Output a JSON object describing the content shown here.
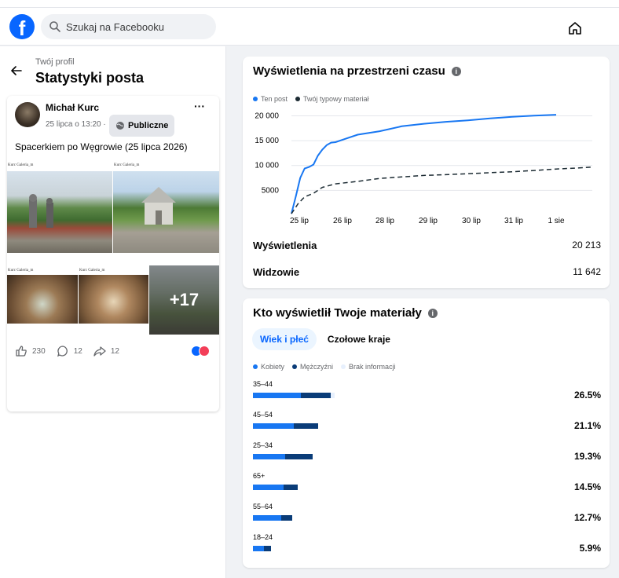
{
  "header": {
    "logo_letter": "f",
    "search_placeholder": "Szukaj na Facebooku",
    "home_icon": "home-icon"
  },
  "left": {
    "breadcrumb": "Twój profil",
    "title": "Statystyki posta"
  },
  "post": {
    "author": "Michał Kurc",
    "date": "25 lipca o 13:20 ·",
    "audience": "Publiczne",
    "more": "···",
    "text": "Spacerkiem po Węgrowie (25 lipca 2026)",
    "photo_title": "Kurc Galeria_m",
    "more_photos": "+17",
    "likes": "230",
    "comments": "12",
    "shares": "12",
    "colors": {
      "like": "#0866ff",
      "love": "#f33e58"
    }
  },
  "views_card": {
    "title": "Wyświetlenia na przestrzeni czasu",
    "info": "i",
    "legend": [
      {
        "label": "Ten post",
        "color": "#1877f2"
      },
      {
        "label": "Twój typowy materiał",
        "color": "#1c2b33"
      }
    ],
    "metrics": [
      {
        "label": "Wyświetlenia",
        "value": "20 213"
      },
      {
        "label": "Widzowie",
        "value": "11 642"
      }
    ]
  },
  "chart_data": {
    "type": "line",
    "title": "Wyświetlenia na przestrzeni czasu",
    "x_ticks": [
      "25 lip",
      "26 lip",
      "28 lip",
      "29 lip",
      "30 lip",
      "31 lip",
      "1 sie"
    ],
    "y_ticks": [
      "5000",
      "10 000",
      "15 000",
      "20 000"
    ],
    "ylim": [
      0,
      21500
    ],
    "x_range": [
      0,
      6.85
    ],
    "grid": true,
    "legend_position": "top-left",
    "series": [
      {
        "name": "Ten post",
        "color": "#1877f2",
        "dash": false,
        "x": [
          0,
          0.1,
          0.2,
          0.3,
          0.4,
          0.5,
          0.6,
          0.7,
          0.8,
          0.9,
          1.0,
          1.2,
          1.5,
          2.0,
          2.5,
          3.0,
          3.5,
          4.0,
          4.5,
          5.0,
          5.5,
          6.0
        ],
        "y": [
          300,
          3800,
          7500,
          9400,
          9700,
          10200,
          12000,
          13200,
          14100,
          14600,
          14700,
          15300,
          16200,
          16900,
          17900,
          18400,
          18800,
          19100,
          19500,
          19800,
          20050,
          20213
        ]
      },
      {
        "name": "Twój typowy materiał",
        "color": "#1c2b33",
        "dash": true,
        "x": [
          0,
          0.15,
          0.3,
          0.5,
          0.7,
          1.0,
          1.5,
          2.0,
          2.5,
          3.0,
          3.5,
          4.0,
          4.5,
          5.0,
          5.5,
          6.0,
          6.5,
          6.85
        ],
        "y": [
          300,
          2300,
          3700,
          4400,
          5600,
          6300,
          6800,
          7400,
          7700,
          8000,
          8150,
          8350,
          8550,
          8750,
          9000,
          9300,
          9500,
          9700
        ]
      }
    ]
  },
  "audience_card": {
    "title": "Kto wyświetlił Twoje materiały",
    "info": "i",
    "tabs": [
      "Wiek i płeć",
      "Czołowe kraje"
    ],
    "legend": [
      {
        "label": "Kobiety",
        "color": "#1877f2"
      },
      {
        "label": "Mężczyźni",
        "color": "#0a3c78"
      },
      {
        "label": "Brak informacji",
        "color": "#e7f0fd"
      }
    ],
    "groups": [
      {
        "label": "35–44",
        "pct": "26.5%",
        "women": 0.137,
        "men": 0.087,
        "unknown": 0.01
      },
      {
        "label": "45–54",
        "pct": "21.1%",
        "women": 0.117,
        "men": 0.07,
        "unknown": 0.0
      },
      {
        "label": "25–34",
        "pct": "19.3%",
        "women": 0.092,
        "men": 0.08,
        "unknown": 0.0
      },
      {
        "label": "65+",
        "pct": "14.5%",
        "women": 0.088,
        "men": 0.04,
        "unknown": 0.0
      },
      {
        "label": "55–64",
        "pct": "12.7%",
        "women": 0.081,
        "men": 0.032,
        "unknown": 0.0
      },
      {
        "label": "18–24",
        "pct": "5.9%",
        "women": 0.031,
        "men": 0.022,
        "unknown": 0.0
      }
    ]
  }
}
